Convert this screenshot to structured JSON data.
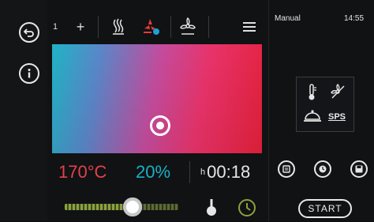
{
  "toolbar": {
    "program_number": "1",
    "plus": "+"
  },
  "readouts": {
    "temperature": "170°C",
    "humidity": "20%",
    "timer_unit": "h",
    "timer_value": "00:18"
  },
  "right_panel": {
    "mode_label": "Manual",
    "clock": "14:55",
    "sps_label": "SPS",
    "start_label": "START"
  },
  "slider": {
    "level_fraction": 0.6
  },
  "colors": {
    "temperature": "#e3414b",
    "humidity": "#19b0c4",
    "accent_green": "#8aa23e",
    "accent_red": "#e83a3a"
  },
  "icons": {
    "left": [
      "back-icon",
      "info-icon"
    ],
    "toolbar": [
      "plus-icon",
      "steam-icon",
      "fan-humidity-icon",
      "fan-icon",
      "menu-icon"
    ],
    "bottom": [
      "core-probe-icon",
      "clock-icon"
    ],
    "right_box": [
      "thermometer-icon",
      "fan-off-icon",
      "cloche-icon"
    ],
    "right_buttons": [
      "recipe-icon",
      "timer-icon",
      "save-icon"
    ]
  }
}
